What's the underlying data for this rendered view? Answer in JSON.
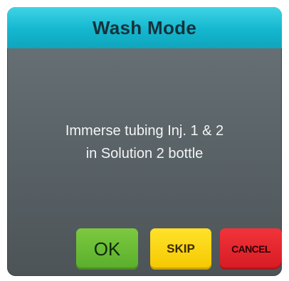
{
  "dialog": {
    "title": "Wash Mode",
    "message_lines": [
      "Immerse tubing Inj. 1 & 2",
      "in Solution 2 bottle"
    ],
    "buttons": {
      "ok_label": "OK",
      "skip_label": "SKIP",
      "cancel_label": "CANCEL"
    },
    "colors": {
      "title_bar": "#14b7cf",
      "body": "#5c6569",
      "ok": "#5aae2b",
      "skip": "#f5c800",
      "cancel": "#d61b22"
    }
  }
}
